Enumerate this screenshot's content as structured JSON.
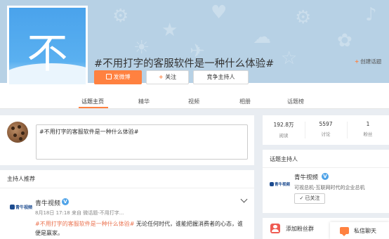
{
  "topic": {
    "avatar_char": "不",
    "title": "#不用打字的客服软件是一种什么体验#",
    "create_label": "创建话题"
  },
  "actions": {
    "post_label": "发微博",
    "follow_label": "关注",
    "host_label": "竞争主持人"
  },
  "tabs": [
    {
      "label": "话题主页",
      "active": true
    },
    {
      "label": "精华",
      "active": false
    },
    {
      "label": "视频",
      "active": false
    },
    {
      "label": "相册",
      "active": false
    },
    {
      "label": "话题榜",
      "active": false
    }
  ],
  "composer": {
    "value": "#不用打字的客服软件是一种什么体验#"
  },
  "feed": {
    "section_title": "主持人推荐",
    "post": {
      "author": "青牛视频",
      "logo_text": "青牛视频",
      "meta": "8月18日 17:18 来自 微话题-不用打字...",
      "tag": "#不用打字的客服软件是一种什么体验#",
      "text": " 无论任何时代，谁能把握消费者的心态，谁便是赢家。"
    }
  },
  "stats": [
    {
      "value": "192.8万",
      "label": "阅读"
    },
    {
      "value": "5597",
      "label": "讨论"
    },
    {
      "value": "1",
      "label": "粉丝"
    }
  ],
  "host": {
    "title": "话题主持人",
    "name": "青牛视频",
    "logo_text": "青牛视频",
    "desc": "可视总机-互联网时代的企业总机",
    "followed_label": "已关注"
  },
  "fan_group": {
    "label": "添加粉丝群"
  },
  "chat": {
    "label": "私信聊天"
  },
  "colors": {
    "accent": "#ff8140",
    "banner": "#b7d1e5",
    "avatar_blue": "#4aa3ec",
    "verified": "#4fa3e8",
    "tag": "#eb7350"
  }
}
